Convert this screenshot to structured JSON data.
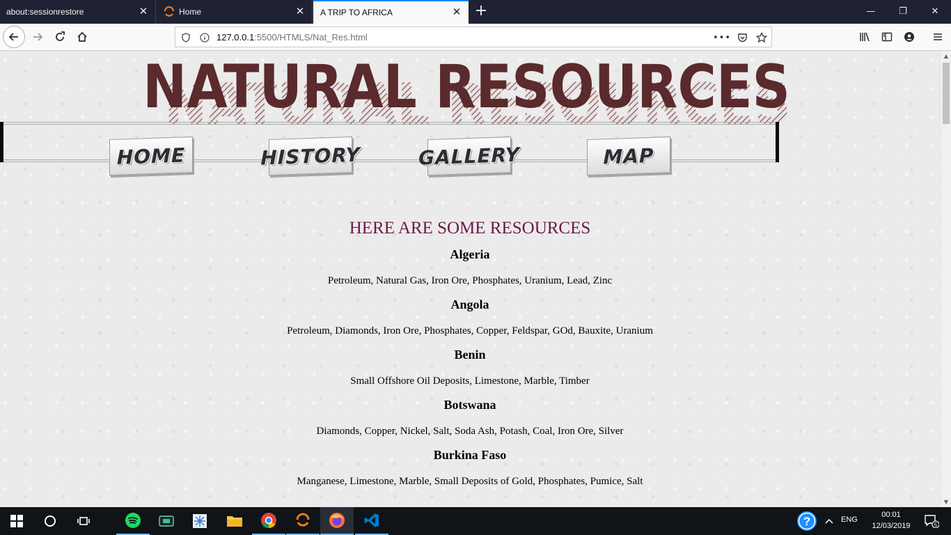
{
  "browser": {
    "tabs": [
      {
        "title": "about:sessionrestore",
        "active": false
      },
      {
        "title": "Home",
        "active": false
      },
      {
        "title": "A TRIP TO AFRICA",
        "active": true
      }
    ],
    "url_host": "127.0.0.1",
    "url_path": ":5500/HTMLS/Nat_Res.html",
    "overflow_icon": "•••"
  },
  "page": {
    "banner_title": "NATURAL RESOURCES",
    "nav": [
      {
        "label": "HOME"
      },
      {
        "label": "HISTORY"
      },
      {
        "label": "GALLERY"
      },
      {
        "label": "MAP"
      }
    ],
    "heading": "HERE ARE SOME RESOURCES",
    "countries": [
      {
        "name": "Algeria",
        "resources": "Petroleum, Natural Gas, Iron Ore, Phosphates, Uranium, Lead, Zinc"
      },
      {
        "name": "Angola",
        "resources": "Petroleum, Diamonds, Iron Ore, Phosphates, Copper, Feldspar, GOd, Bauxite, Uranium"
      },
      {
        "name": "Benin",
        "resources": "Small Offshore Oil Deposits, Limestone, Marble, Timber"
      },
      {
        "name": "Botswana",
        "resources": "Diamonds, Copper, Nickel, Salt, Soda Ash, Potash, Coal, Iron Ore, Silver"
      },
      {
        "name": "Burkina Faso",
        "resources": "Manganese, Limestone, Marble, Small Deposits of Gold, Phosphates, Pumice, Salt"
      }
    ],
    "heading_color": "#6b1a47",
    "title_color": "#5a2a2c"
  },
  "taskbar": {
    "lang": "ENG",
    "time": "00:01",
    "date": "12/03/2019",
    "notification_count": "5",
    "help_icon_label": "?"
  }
}
